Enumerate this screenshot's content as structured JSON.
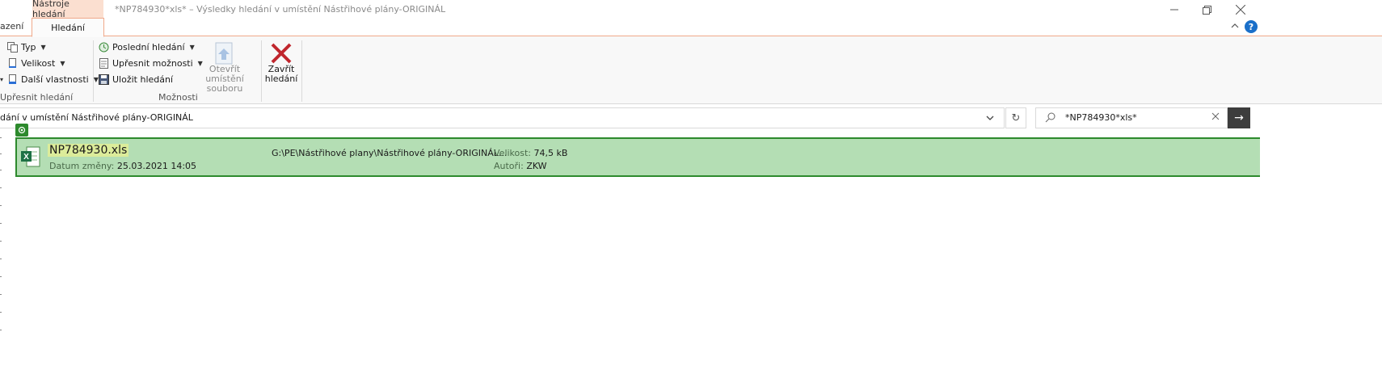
{
  "window": {
    "context_tab": "Nástroje hledání",
    "title": "*NP784930*xls* – Výsledky hledání v umístění Nástřihové plány-ORIGINÁL"
  },
  "ribbon": {
    "prev_tab_partial": "azení",
    "active_tab": "Hledání",
    "refine": {
      "type_label": "Typ",
      "size_label": "Velikost",
      "other_props_label": "Další vlastnosti",
      "group_label": "Upřesnit hledání"
    },
    "options": {
      "recent_label": "Poslední hledání",
      "advanced_label": "Upřesnit možnosti",
      "save_label": "Uložit hledání",
      "open_location_label": "Otevřít umístění souboru",
      "group_label": "Možnosti"
    },
    "close_label": "Zavřít hledání"
  },
  "address": {
    "path_text": "dání v umístění Nástřihové plány-ORIGINÁL"
  },
  "search": {
    "value": "*NP784930*xls*"
  },
  "results": [
    {
      "name": "NP784930.xls",
      "modified_label": "Datum změny:",
      "modified_value": "25.03.2021 14:05",
      "path": "G:\\PE\\Nástřihové plany\\Nástřihové plány-ORIGINÁL...",
      "size_label": "Velikost:",
      "size_value": "74,5 kB",
      "authors_label": "Autoři:",
      "authors_value": "ZKW"
    }
  ],
  "colors": {
    "selection_bg": "#b4deb4",
    "selection_border": "#2d8a2d",
    "context_tab": "#fbdfd0",
    "close_red": "#c0262d"
  }
}
